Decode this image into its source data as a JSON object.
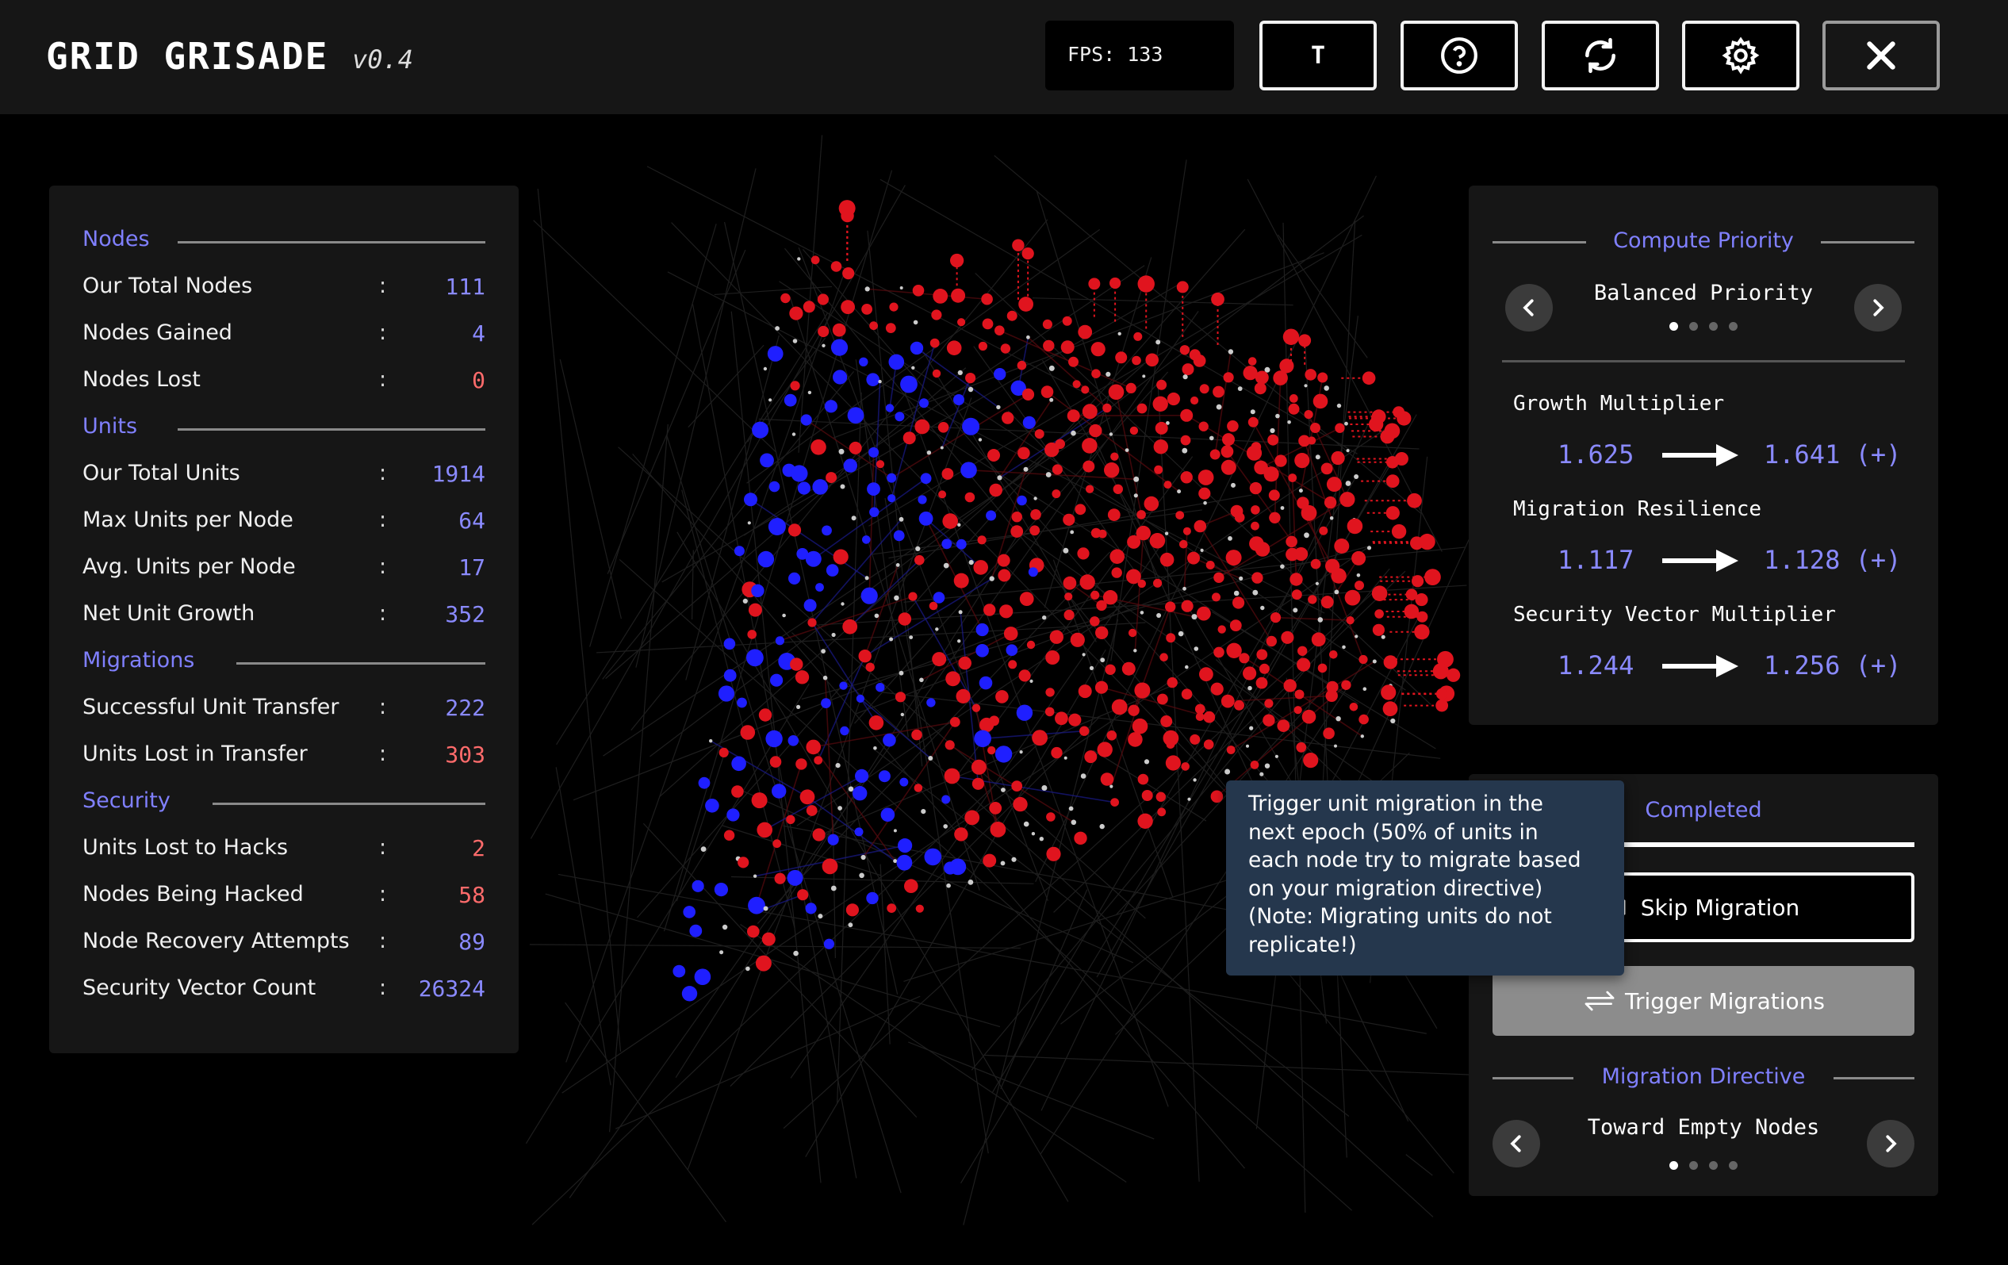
{
  "app": {
    "title": "GRID GRISADE",
    "version": "v0.4",
    "fps": "FPS: 133"
  },
  "toolbar": {
    "text_button_label": "T",
    "help_icon": "help-circle-icon",
    "reset_icon": "refresh-icon",
    "settings_icon": "gear-icon",
    "close_icon": "close-icon"
  },
  "stats": {
    "colon": ":",
    "sections": [
      {
        "title": "Nodes",
        "rows": [
          {
            "label": "Our Total Nodes",
            "value": "111",
            "color": "blue"
          },
          {
            "label": "Nodes Gained",
            "value": "4",
            "color": "blue"
          },
          {
            "label": "Nodes Lost",
            "value": "0",
            "color": "red"
          }
        ]
      },
      {
        "title": "Units",
        "rows": [
          {
            "label": "Our Total Units",
            "value": "1914",
            "color": "blue"
          },
          {
            "label": "Max Units per Node",
            "value": "64",
            "color": "blue"
          },
          {
            "label": "Avg. Units per Node",
            "value": "17",
            "color": "blue"
          },
          {
            "label": "Net Unit Growth",
            "value": "352",
            "color": "blue"
          }
        ]
      },
      {
        "title": "Migrations",
        "rows": [
          {
            "label": "Successful Unit Transfer",
            "value": "222",
            "color": "blue"
          },
          {
            "label": "Units Lost in Transfer",
            "value": "303",
            "color": "red"
          }
        ]
      },
      {
        "title": "Security",
        "rows": [
          {
            "label": "Units Lost to Hacks",
            "value": "2",
            "color": "red"
          },
          {
            "label": "Nodes Being Hacked",
            "value": "58",
            "color": "red"
          },
          {
            "label": "Node Recovery Attempts",
            "value": "89",
            "color": "blue"
          },
          {
            "label": "Security Vector Count",
            "value": "26324",
            "color": "blue"
          }
        ]
      }
    ]
  },
  "compute_priority": {
    "title": "Compute Priority",
    "selected": "Balanced Priority",
    "page_index": 0,
    "page_count": 4,
    "multipliers": [
      {
        "label": "Growth Multiplier",
        "from": "1.625",
        "to": "1.641 (+)"
      },
      {
        "label": "Migration Resilience",
        "from": "1.117",
        "to": "1.128 (+)"
      },
      {
        "label": "Security Vector Multiplier",
        "from": "1.244",
        "to": "1.256 (+)"
      }
    ]
  },
  "migration": {
    "progress_label": "Completed",
    "progress": 1.0,
    "skip_label": "Skip Migration",
    "trigger_label": "Trigger Migrations",
    "directive_title": "Migration Directive",
    "directive_selected": "Toward Empty Nodes",
    "directive_index": 0,
    "directive_count": 4
  },
  "tooltip": {
    "text": "Trigger unit migration in the\nnext epoch (50% of units in\neach node try to migrate based\non your migration directive)\n(Note: Migrating units do not\nreplicate!)"
  },
  "colors": {
    "enemy_node": "#e0141e",
    "our_node": "#1f1fff",
    "neutral_node": "#cccccc",
    "accent": "#8080ff",
    "danger_value": "#ff6b6b"
  }
}
